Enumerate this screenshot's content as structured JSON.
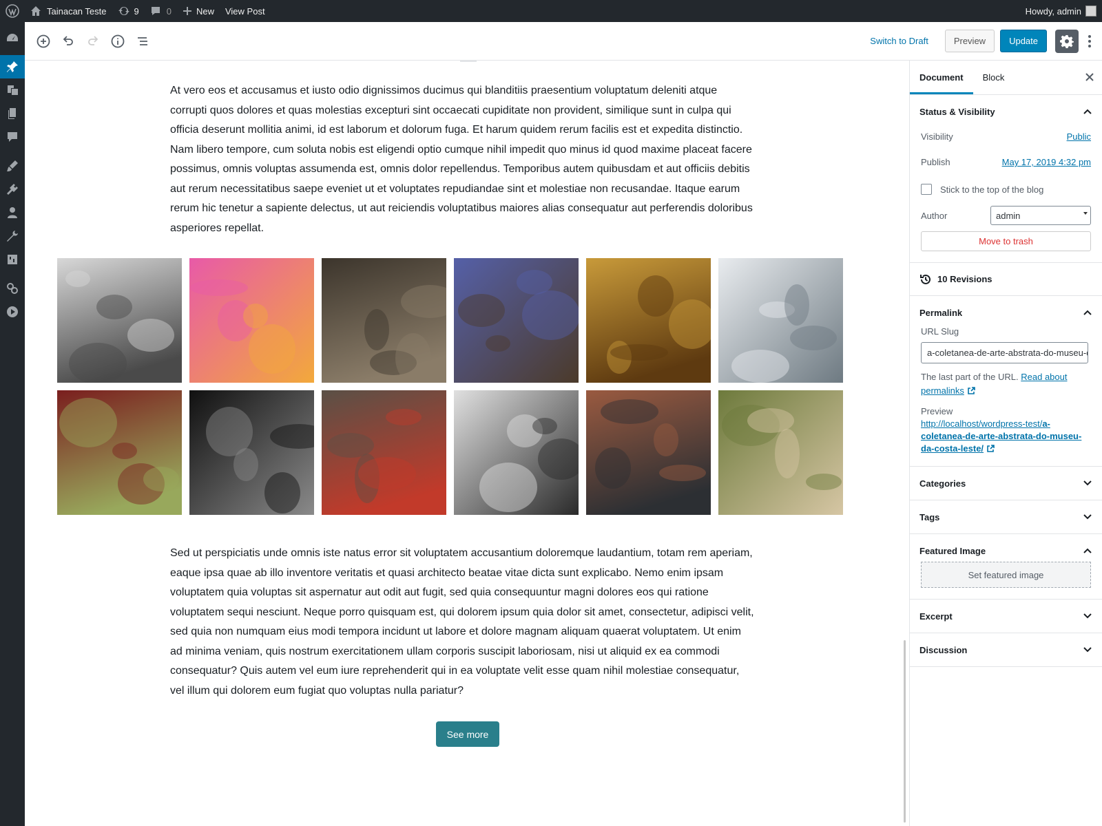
{
  "admin_bar": {
    "site_name": "Tainacan Teste",
    "updates_count": "9",
    "comments_count": "0",
    "new_label": "New",
    "view_post_label": "View Post",
    "greeting": "Howdy, admin"
  },
  "admin_menu": {
    "items": [
      "dashboard-icon",
      "posts-icon",
      "media-icon",
      "pages-icon",
      "comments-icon",
      "appearance-icon",
      "plugins-icon",
      "users-icon",
      "tools-icon",
      "settings-icon",
      "tainacan-icon",
      "video-icon"
    ],
    "active": "posts-icon"
  },
  "toolbar": {
    "switch_draft_label": "Switch to Draft",
    "preview_label": "Preview",
    "update_label": "Update"
  },
  "content": {
    "paragraph1": "At vero eos et accusamus et iusto odio dignissimos ducimus qui blanditiis praesentium voluptatum deleniti atque corrupti quos dolores et quas molestias excepturi sint occaecati cupiditate non provident, similique sunt in culpa qui officia deserunt mollitia animi, id est laborum et dolorum fuga. Et harum quidem rerum facilis est et expedita distinctio. Nam libero tempore, cum soluta nobis est eligendi optio cumque nihil impedit quo minus id quod maxime placeat facere possimus, omnis voluptas assumenda est, omnis dolor repellendus. Temporibus autem quibusdam et aut officiis debitis aut rerum necessitatibus saepe eveniet ut et voluptates repudiandae sint et molestiae non recusandae. Itaque earum rerum hic tenetur a sapiente delectus, ut aut reiciendis voluptatibus maiores alias consequatur aut perferendis doloribus asperiores repellat.",
    "paragraph2": "Sed ut perspiciatis unde omnis iste natus error sit voluptatem accusantium doloremque laudantium, totam rem aperiam, eaque ipsa quae ab illo inventore veritatis et quasi architecto beatae vitae dicta sunt explicabo. Nemo enim ipsam voluptatem quia voluptas sit aspernatur aut odit aut fugit, sed quia consequuntur magni dolores eos qui ratione voluptatem sequi nesciunt. Neque porro quisquam est, qui dolorem ipsum quia dolor sit amet, consectetur, adipisci velit, sed quia non numquam eius modi tempora incidunt ut labore et dolore magnam aliquam quaerat voluptatem. Ut enim ad minima veniam, quis nostrum exercitationem ullam corporis suscipit laboriosam, nisi ut aliquid ex ea commodi consequatur? Quis autem vel eum iure reprehenderit qui in ea voluptate velit esse quam nihil molestiae consequatur, vel illum qui dolorem eum fugiat quo voluptas nulla pariatur?",
    "see_more_label": "See more",
    "gallery": [
      {
        "name": "fork-photo",
        "colors": [
          "#d8d8d8",
          "#4a4a4a"
        ]
      },
      {
        "name": "flowers-collage",
        "colors": [
          "#e85aa8",
          "#f2a93b"
        ]
      },
      {
        "name": "misty-mountains-painting",
        "colors": [
          "#3c352c",
          "#8a7c68"
        ]
      },
      {
        "name": "bearded-men-portrait",
        "colors": [
          "#5560a8",
          "#4b3a2a"
        ]
      },
      {
        "name": "ornate-ceiling-hall",
        "colors": [
          "#c89a3a",
          "#5e3a10"
        ]
      },
      {
        "name": "snowy-valley-aerial",
        "colors": [
          "#e9ecef",
          "#6e7a82"
        ]
      },
      {
        "name": "henna-hand-sculpture",
        "colors": [
          "#7a1e1e",
          "#98a85c"
        ]
      },
      {
        "name": "night-street-bw",
        "colors": [
          "#101010",
          "#8a8a8a"
        ]
      },
      {
        "name": "house-porch-flowers",
        "colors": [
          "#5a5046",
          "#c23a2a"
        ]
      },
      {
        "name": "people-walking-bw",
        "colors": [
          "#e0e0e0",
          "#2a2a2a"
        ]
      },
      {
        "name": "brick-warehouse-canal",
        "colors": [
          "#9a5a40",
          "#2c2f33"
        ]
      },
      {
        "name": "blurred-table-bokeh",
        "colors": [
          "#6d7a3c",
          "#d6c6a4"
        ]
      }
    ]
  },
  "sidebar": {
    "tab_document": "Document",
    "tab_block": "Block",
    "status_title": "Status & Visibility",
    "visibility_label": "Visibility",
    "visibility_value": "Public",
    "publish_label": "Publish",
    "publish_value": "May 17, 2019 4:32 pm",
    "sticky_label": "Stick to the top of the blog",
    "author_label": "Author",
    "author_value": "admin",
    "trash_label": "Move to trash",
    "revisions_label": "10 Revisions",
    "permalink_title": "Permalink",
    "url_slug_label": "URL Slug",
    "url_slug_value": "a-coletanea-de-arte-abstrata-do-museu-da-costa-leste",
    "help_text": "The last part of the URL.",
    "help_link": "Read about permalinks",
    "preview_label": "Preview",
    "preview_url_base": "http://localhost/wordpress-test/",
    "preview_url_slug": "a-coletanea-de-arte-abstrata-do-museu-da-costa-leste/",
    "categories_title": "Categories",
    "tags_title": "Tags",
    "featured_title": "Featured Image",
    "set_featured_label": "Set featured image",
    "excerpt_title": "Excerpt",
    "discussion_title": "Discussion"
  },
  "colors": {
    "admin_bar": "#23282d",
    "accent": "#0085ba",
    "active_menu": "#0073aa",
    "see_more": "#2a7f8b",
    "trash": "#dc3232"
  }
}
